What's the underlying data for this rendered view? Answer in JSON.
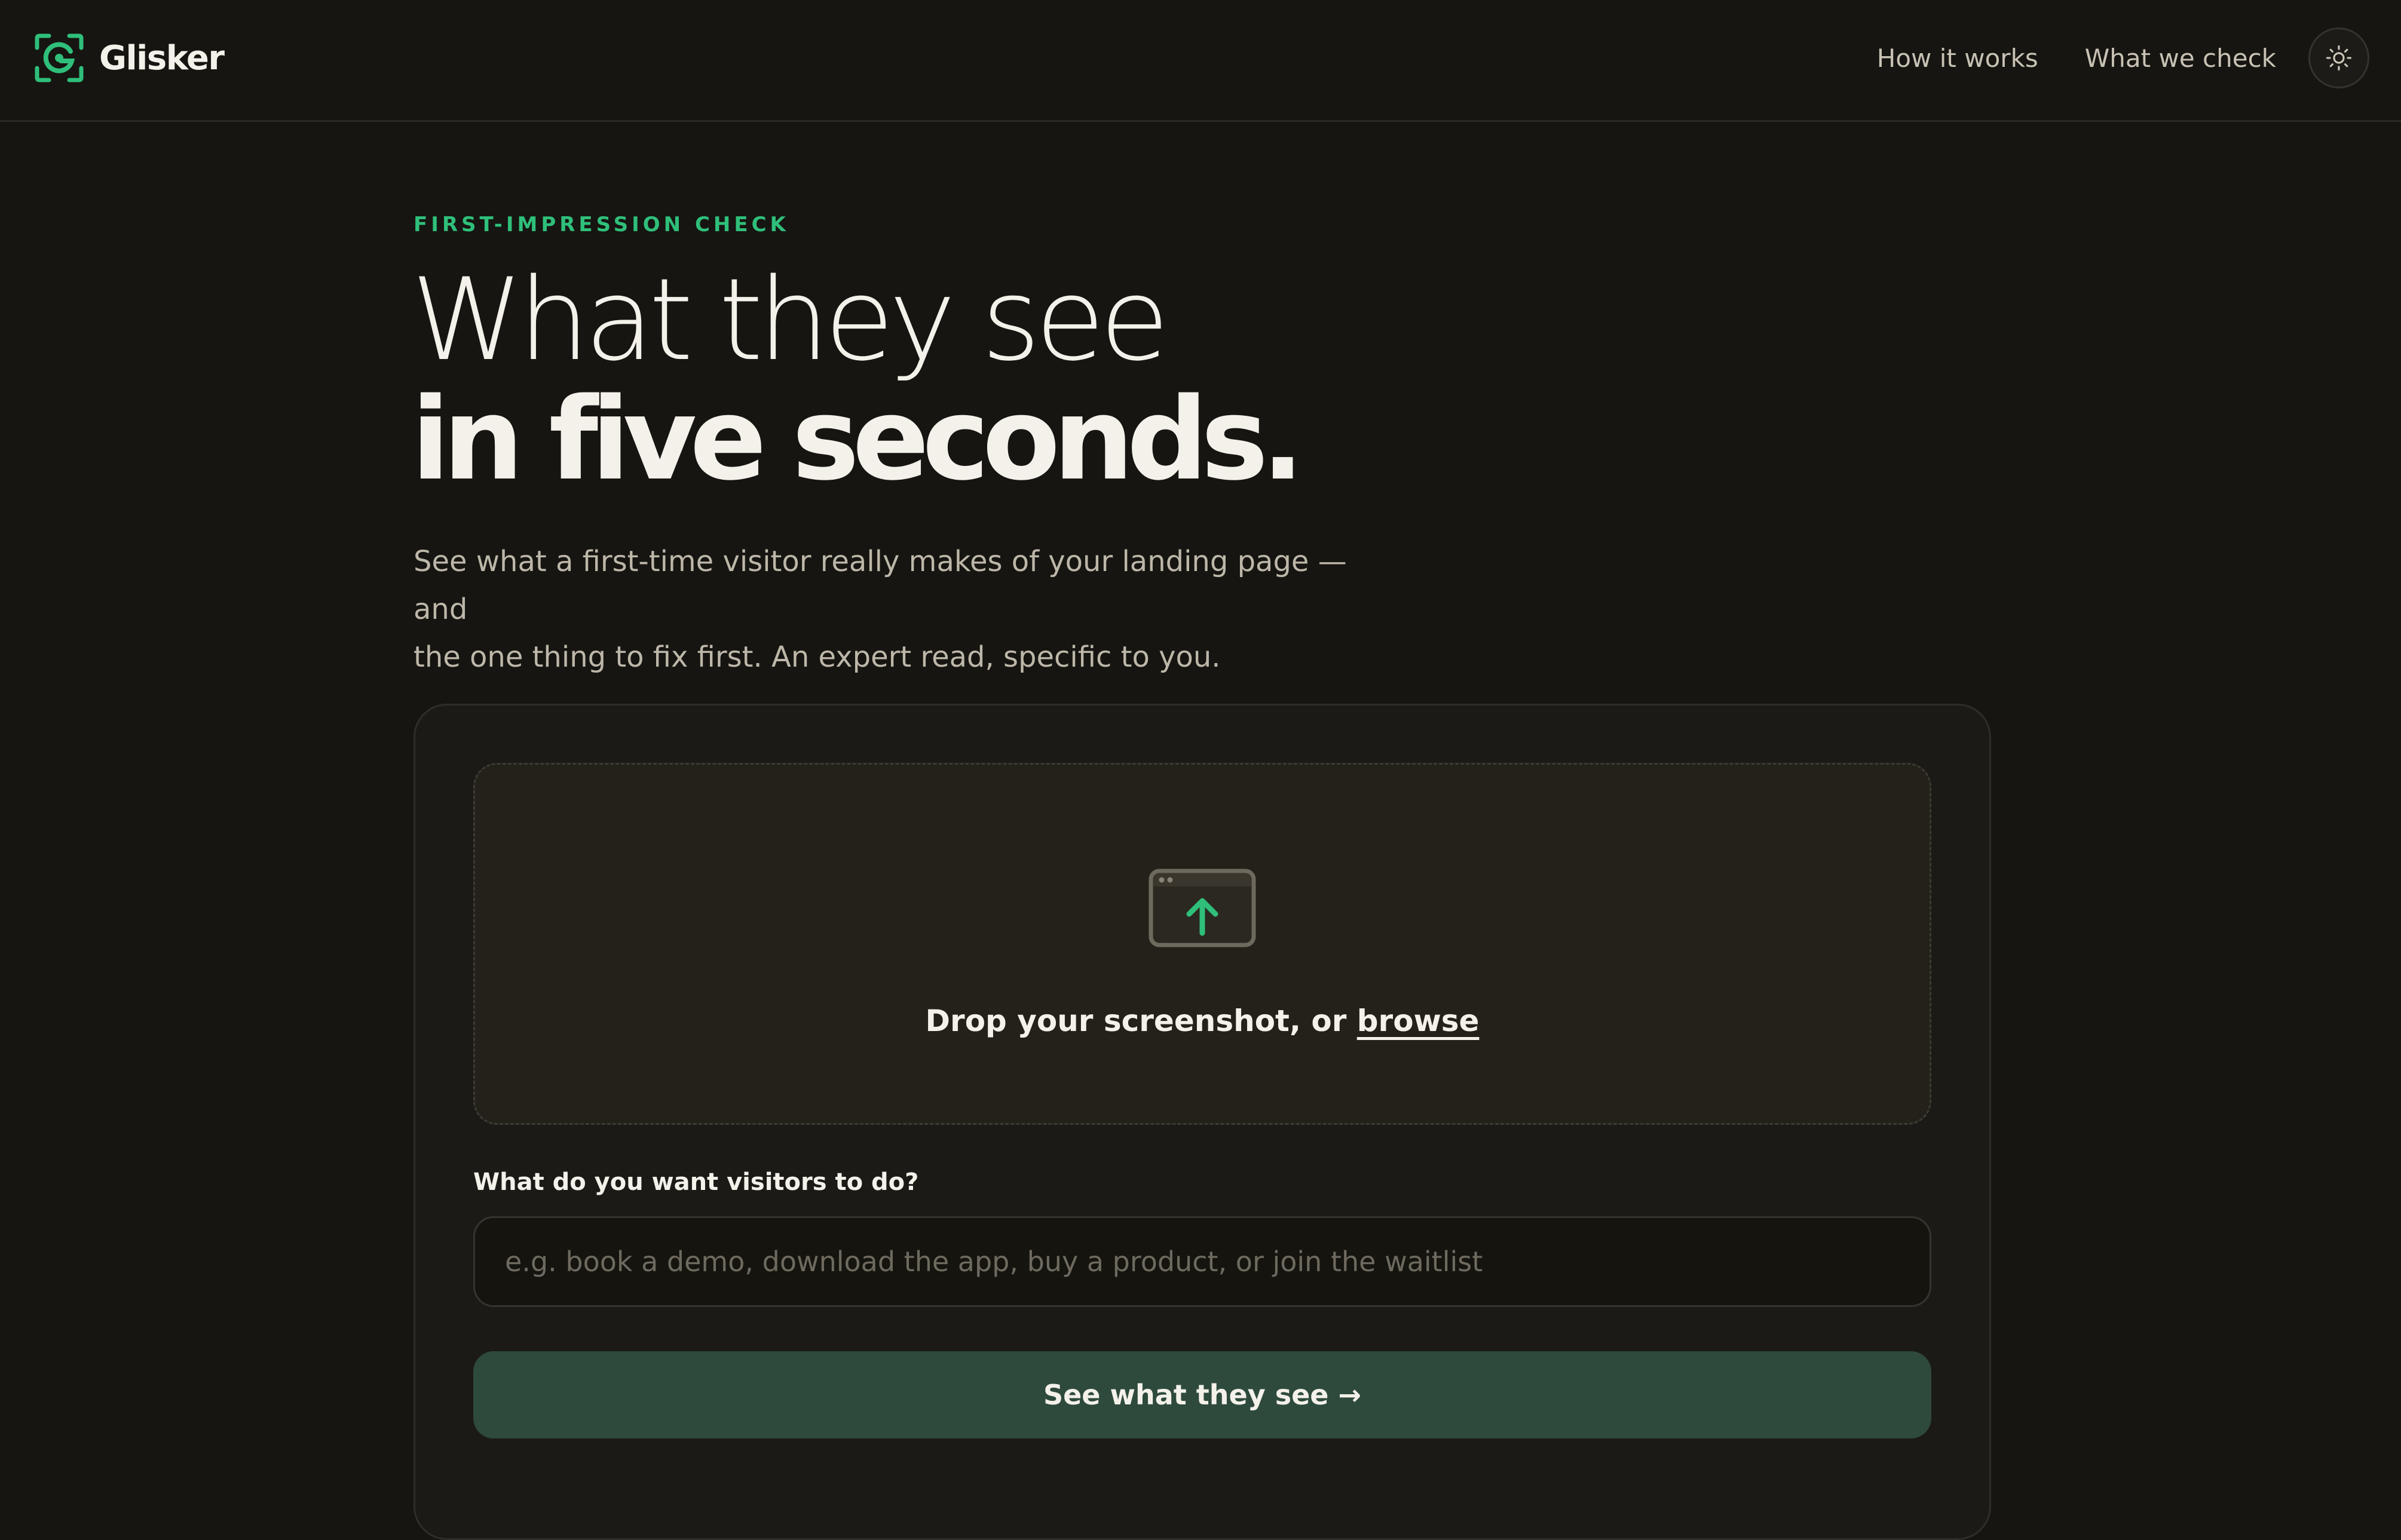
{
  "header": {
    "brand_name": "Glisker",
    "nav": [
      {
        "label": "How it works"
      },
      {
        "label": "What we check"
      }
    ],
    "theme_toggle_icon": "sun-icon"
  },
  "hero": {
    "eyebrow": "FIRST-IMPRESSION CHECK",
    "title_line1": "What they see",
    "title_line2": "in five seconds.",
    "subtitle_line1": "See what a first-time visitor really makes of your landing page — and",
    "subtitle_line2": "the one thing to fix first. An expert read, specific to you."
  },
  "upload": {
    "icon": "upload-window-icon",
    "prompt": "Drop your screenshot, or ",
    "browse_label": "browse"
  },
  "goal": {
    "label": "What do you want visitors to do?",
    "value": "",
    "placeholder": "e.g. book a demo, download the app, buy a product, or join the waitlist"
  },
  "submit": {
    "label": "See what they see →"
  },
  "colors": {
    "background": "#161512",
    "accent": "#2fbf7a",
    "button": "#2d4a3c",
    "card": "#1c1a16"
  }
}
